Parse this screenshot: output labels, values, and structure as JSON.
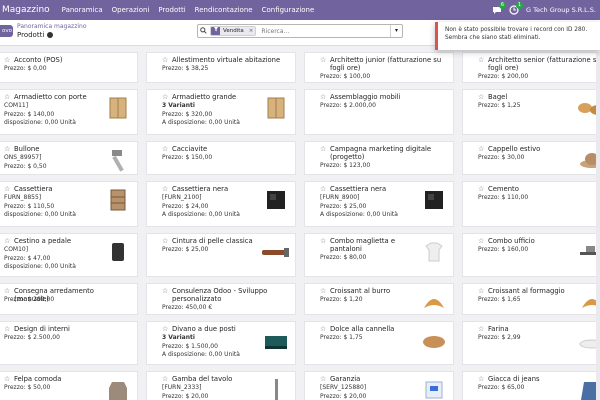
{
  "navbar": {
    "app_name": "Magazzino",
    "menu": [
      "Panoramica",
      "Operazioni",
      "Prodotti",
      "Rendicontazione",
      "Configurazione"
    ],
    "chat_badge": "6",
    "activity_badge": "1",
    "company": "G Tech Group S.R.L.S.",
    "color": "#71639e"
  },
  "control": {
    "new_label": "ovo",
    "breadcrumb": "Panoramica magazzino",
    "title": "Prodotti",
    "search": {
      "facet_label": "Vendita",
      "placeholder": "Ricerca..."
    }
  },
  "toast": {
    "message": "Non è stato possibile trovare i record con ID 280. Sembra che siano stati eliminati.",
    "accent": "#d9534f"
  },
  "products": [
    {
      "name": "Acconto (POS)",
      "lines": [
        "Prezzo: $ 0,00"
      ]
    },
    {
      "name": "Allestimento virtuale abitazione",
      "lines": [
        "Prezzo: $ 38,25"
      ]
    },
    {
      "name": "Architetto junior (fatturazione su fogli ore)",
      "lines": [
        "Prezzo: $ 100,00"
      ]
    },
    {
      "name": "Architetto senior (fatturazione su fogli ore)",
      "lines": [
        "Prezzo: $ 200,00"
      ]
    },
    {
      "name": "Armadietto con porte",
      "lines": [
        "COM11]",
        "Prezzo: $ 140,00",
        "disposizione: 0,00 Unità"
      ],
      "image": "cabinet"
    },
    {
      "name": "Armadietto grande",
      "lines": [
        "3 Varianti",
        "Prezzo: $ 320,00",
        "A disposizione: 0,00 Unità"
      ],
      "bold_first": true,
      "image": "cabinet"
    },
    {
      "name": "Assemblaggio mobili",
      "lines": [
        "Prezzo: $ 2.000,00"
      ]
    },
    {
      "name": "Bagel",
      "lines": [
        "Prezzo: $ 1,25"
      ],
      "image": "bagel"
    },
    {
      "name": "Bullone",
      "lines": [
        "ONS_89957]",
        "Prezzo: $ 0,50"
      ],
      "image": "bolt"
    },
    {
      "name": "Cacciavite",
      "lines": [
        "Prezzo: $ 150,00"
      ]
    },
    {
      "name": "Campagna marketing digitale (progetto)",
      "lines": [
        "Prezzo: $ 123,00"
      ]
    },
    {
      "name": "Cappello estivo",
      "lines": [
        "Prezzo: $ 30,00"
      ],
      "image": "hat"
    },
    {
      "name": "Cassettiera",
      "lines": [
        "FURN_8855]",
        "Prezzo: $ 110,50",
        "disposizione: 0,00 Unità"
      ],
      "image": "drawer"
    },
    {
      "name": "Cassettiera nera",
      "lines": [
        "[FURN_2100]",
        "Prezzo: $ 24,00",
        "A disposizione: 0,00 Unità"
      ],
      "image": "blackbox"
    },
    {
      "name": "Cassettiera nera",
      "lines": [
        "[FURN_8900]",
        "Prezzo: $ 25,00",
        "A disposizione: 0,00 Unità"
      ],
      "image": "blackbox"
    },
    {
      "name": "Cemento",
      "lines": [
        "Prezzo: $ 110,00"
      ]
    },
    {
      "name": "Cestino a pedale",
      "lines": [
        "COM10]",
        "Prezzo: $ 47,00",
        "disposizione: 0,00 Unità"
      ],
      "image": "bin"
    },
    {
      "name": "Cintura di pelle classica",
      "lines": [
        "Prezzo: $ 25,00"
      ],
      "image": "belt"
    },
    {
      "name": "Combo maglietta e pantaloni",
      "lines": [
        "Prezzo: $ 80,00"
      ],
      "image": "shirt"
    },
    {
      "name": "Combo ufficio",
      "lines": [
        "Prezzo: $ 160,00"
      ],
      "image": "office"
    },
    {
      "name": "Consegna arredamento (manuale)",
      "lines": [
        "Prezzo: $ 200,00"
      ]
    },
    {
      "name": "Consulenza Odoo - Sviluppo personalizzato",
      "lines": [
        "Prezzo: 450,00 €"
      ]
    },
    {
      "name": "Croissant al burro",
      "lines": [
        "Prezzo: $ 1,20"
      ],
      "image": "croissant"
    },
    {
      "name": "Croissant al formaggio",
      "lines": [
        "Prezzo: $ 1,65"
      ],
      "image": "croissant"
    },
    {
      "name": "Design di interni",
      "lines": [
        "Prezzo: $ 2.500,00"
      ]
    },
    {
      "name": "Divano a due posti",
      "lines": [
        "3 Varianti",
        "Prezzo: $ 1.500,00",
        "A disposizione: 0,00 Unità"
      ],
      "bold_first": true,
      "image": "sofa"
    },
    {
      "name": "Dolce alla cannella",
      "lines": [
        "Prezzo: $ 1,75"
      ],
      "image": "pastry"
    },
    {
      "name": "Farina",
      "lines": [
        "Prezzo: $ 2,99"
      ],
      "image": "flour"
    },
    {
      "name": "Felpa comoda",
      "lines": [
        "Prezzo: $ 50,00"
      ],
      "image": "hoodie"
    },
    {
      "name": "Gamba del tavolo",
      "lines": [
        "[FURN_2333]",
        "Prezzo: $ 20,00"
      ],
      "image": "leg"
    },
    {
      "name": "Garanzia",
      "lines": [
        "[SERV_125880]",
        "Prezzo: $ 20,00"
      ],
      "image": "box"
    },
    {
      "name": "Giacca di jeans",
      "lines": [
        "Prezzo: $ 65,00"
      ],
      "image": "jacket"
    }
  ]
}
